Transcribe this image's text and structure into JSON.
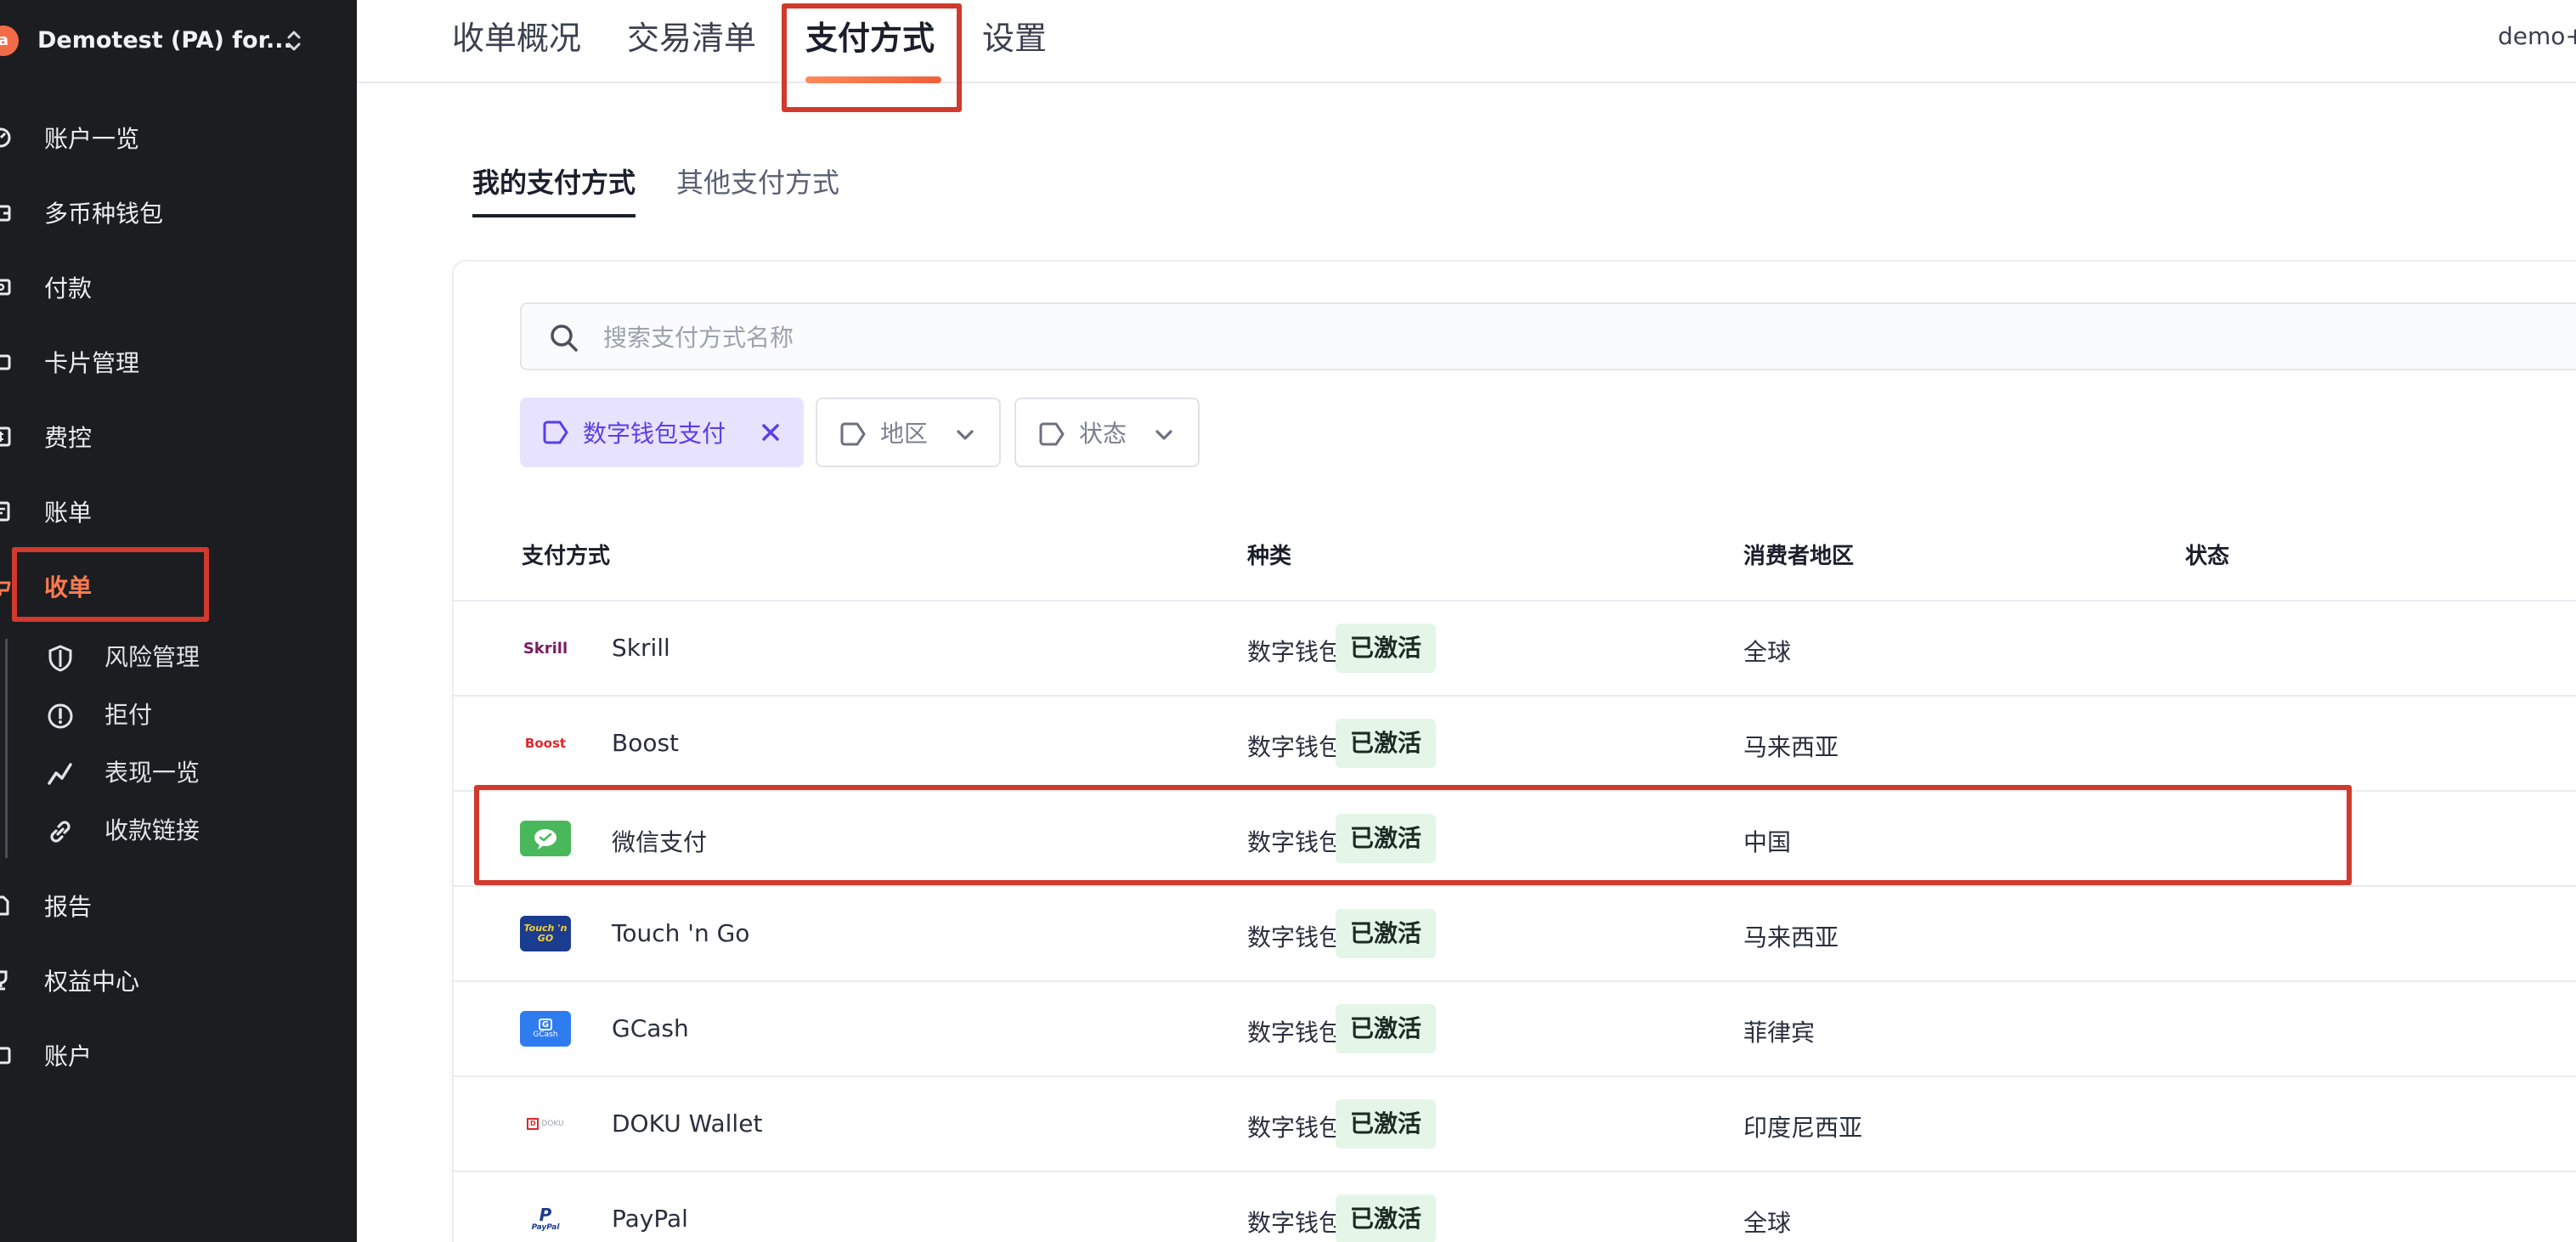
{
  "org": {
    "name": "Demotest (PA) for..."
  },
  "sidebar": {
    "items": [
      {
        "label": "账户一览",
        "icon": "dashboard-icon"
      },
      {
        "label": "多币种钱包",
        "icon": "wallet-icon"
      },
      {
        "label": "付款",
        "icon": "payout-icon"
      },
      {
        "label": "卡片管理",
        "icon": "card-icon"
      },
      {
        "label": "费控",
        "icon": "expense-icon"
      },
      {
        "label": "账单",
        "icon": "bill-icon"
      },
      {
        "label": "收单",
        "icon": "acquiring-icon",
        "active": true
      },
      {
        "label": "报告",
        "icon": "report-icon"
      },
      {
        "label": "权益中心",
        "icon": "rewards-icon"
      },
      {
        "label": "账户",
        "icon": "account-icon"
      }
    ],
    "sub_items": [
      {
        "label": "风险管理",
        "icon": "shield-icon"
      },
      {
        "label": "拒付",
        "icon": "alert-circle-icon"
      },
      {
        "label": "表现一览",
        "icon": "trend-icon"
      },
      {
        "label": "收款链接",
        "icon": "link-icon"
      }
    ]
  },
  "topbar": {
    "tabs": [
      {
        "label": "收单概况"
      },
      {
        "label": "交易清单"
      },
      {
        "label": "支付方式",
        "active": true
      },
      {
        "label": "设置"
      }
    ],
    "user": "demo+c"
  },
  "subtabs": [
    {
      "label": "我的支付方式",
      "active": true
    },
    {
      "label": "其他支付方式"
    }
  ],
  "search": {
    "placeholder": "搜索支付方式名称",
    "value": ""
  },
  "filters": [
    {
      "label": "数字钱包支付",
      "active": true
    },
    {
      "label": "地区"
    },
    {
      "label": "状态"
    }
  ],
  "table": {
    "headers": [
      "支付方式",
      "种类",
      "消费者地区",
      "状态"
    ],
    "rows": [
      {
        "name": "Skrill",
        "type": "数字钱包支付",
        "region": "全球",
        "status": "已激活",
        "logo": "skrill-logo",
        "logo_text": "Skrill"
      },
      {
        "name": "Boost",
        "type": "数字钱包支付",
        "region": "马来西亚",
        "status": "已激活",
        "logo": "boost-logo",
        "logo_text": "Boost"
      },
      {
        "name": "微信支付",
        "type": "数字钱包支付",
        "region": "中国",
        "status": "已激活",
        "logo": "wechat-pay-logo",
        "logo_text": ""
      },
      {
        "name": "Touch 'n Go",
        "type": "数字钱包支付",
        "region": "马来西亚",
        "status": "已激活",
        "logo": "touch-n-go-logo",
        "logo_text": "Touch 'n GO"
      },
      {
        "name": "GCash",
        "type": "数字钱包支付",
        "region": "菲律宾",
        "status": "已激活",
        "logo": "gcash-logo",
        "logo_text": "GCash"
      },
      {
        "name": "DOKU Wallet",
        "type": "数字钱包支付",
        "region": "印度尼西亚",
        "status": "已激活",
        "logo": "doku-logo",
        "logo_text": "DOKU"
      },
      {
        "name": "PayPal",
        "type": "数字钱包支付",
        "region": "全球",
        "status": "已激活",
        "logo": "paypal-logo",
        "logo_text": "PayPal"
      }
    ]
  },
  "colors": {
    "sidebar_bg": "#1c1d21",
    "accent": "#ff7a4f",
    "highlight_border": "#d13a2c",
    "chip_active_bg": "#e7e3ff",
    "chip_active_text": "#5b3ee8",
    "status_bg": "#e4f6e8"
  }
}
